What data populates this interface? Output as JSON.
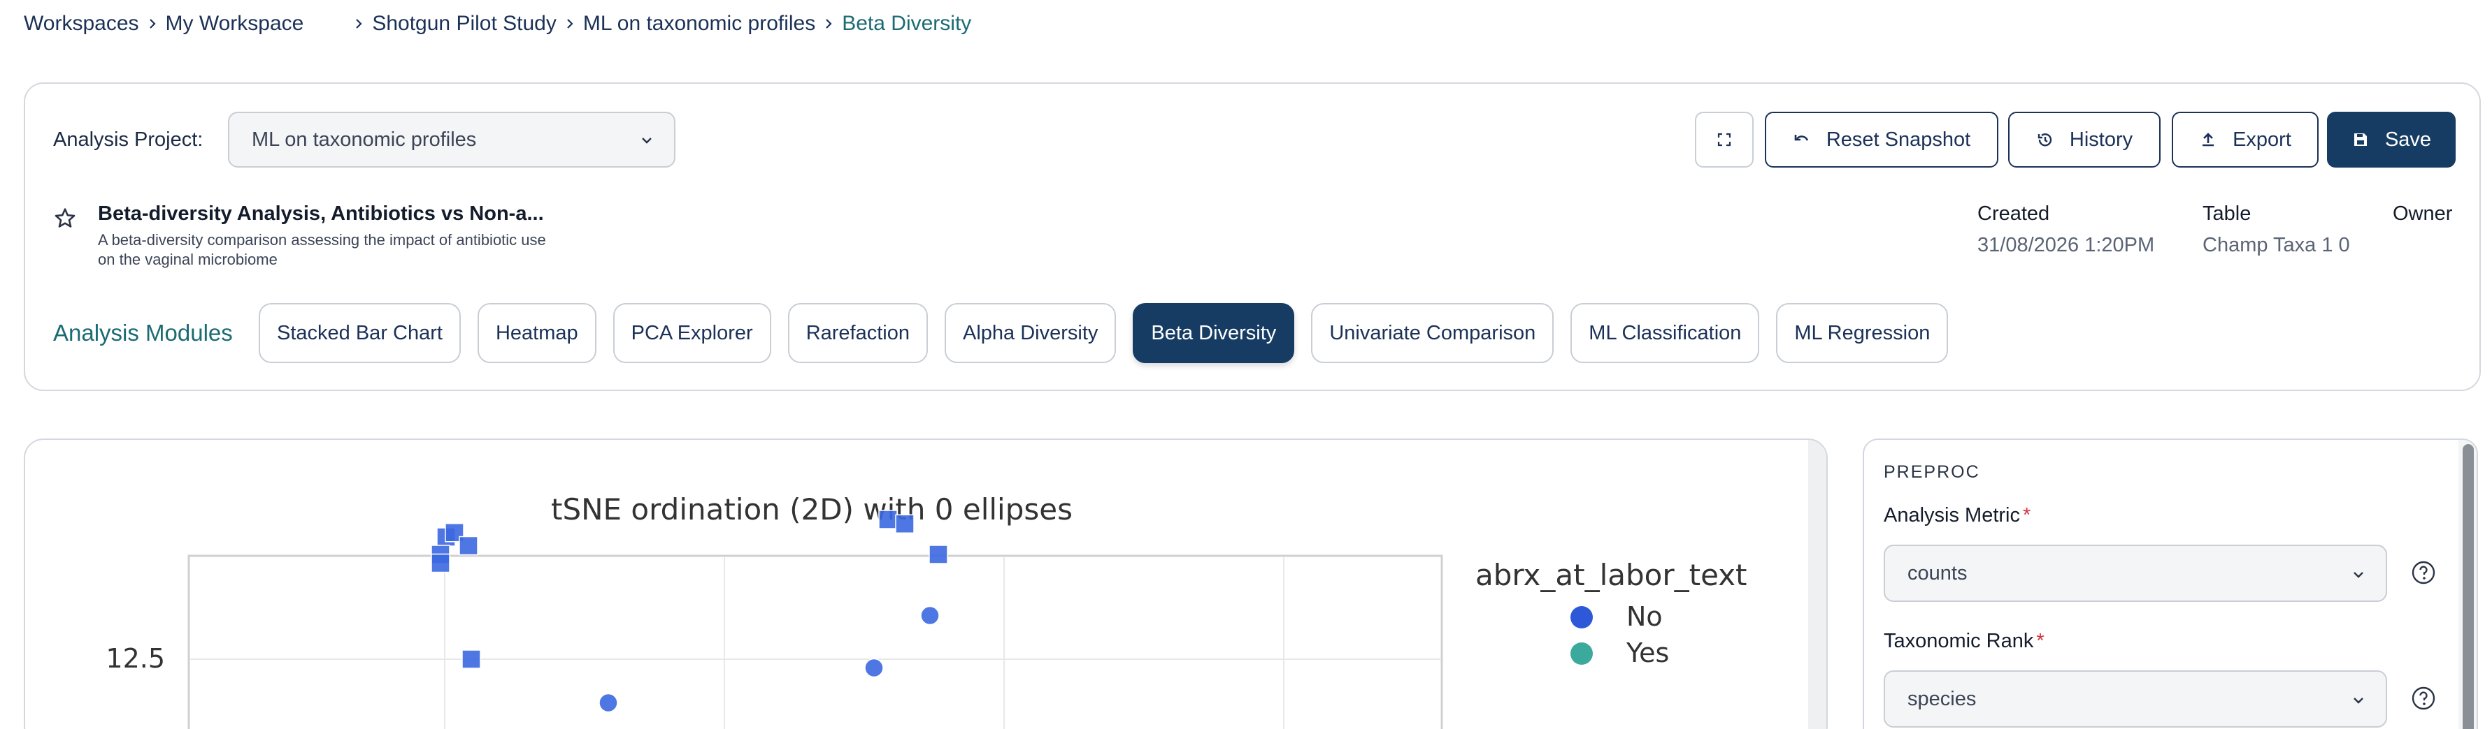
{
  "breadcrumb": {
    "items": [
      "Workspaces",
      "My Workspace",
      "Shotgun Pilot Study",
      "ML on taxonomic profiles",
      "Beta Diversity"
    ]
  },
  "project": {
    "label": "Analysis Project:",
    "selected": "ML on taxonomic profiles"
  },
  "toolbar": {
    "fullscreen_icon": "expand-icon",
    "reset_label": "Reset Snapshot",
    "history_label": "History",
    "export_label": "Export",
    "save_label": "Save"
  },
  "analysis": {
    "title": "Beta-diversity Analysis, Antibiotics vs Non-a...",
    "description": "A beta-diversity comparison assessing the impact of antibiotic use on the vaginal microbiome",
    "created_label": "Created",
    "created_value": "31/08/2026 1:20PM",
    "table_label": "Table",
    "table_value": "Champ Taxa 1 0",
    "owner_label": "Owner"
  },
  "modules": {
    "label": "Analysis Modules",
    "items": [
      "Stacked Bar Chart",
      "Heatmap",
      "PCA Explorer",
      "Rarefaction",
      "Alpha Diversity",
      "Beta Diversity",
      "Univariate Comparison",
      "ML Classification",
      "ML Regression"
    ],
    "active": "Beta Diversity"
  },
  "chart_data": {
    "type": "scatter",
    "title": "tSNE ordination (2D) with 0 ellipses",
    "ytick": "12.5",
    "legend": {
      "title": "abrx_at_labor_text",
      "entries": [
        {
          "label": "No",
          "color": "#2d59d9"
        },
        {
          "label": "Yes",
          "color": "#3ba99c"
        }
      ]
    },
    "series": [
      {
        "marker": "square",
        "color": "#3c68e0",
        "points": [
          [
            0.92,
            13.9
          ],
          [
            0.95,
            13.95
          ],
          [
            0.9,
            13.7
          ],
          [
            0.9,
            13.6
          ],
          [
            1.0,
            13.8
          ],
          [
            1.01,
            12.5
          ],
          [
            2.5,
            14.1
          ],
          [
            2.56,
            14.05
          ],
          [
            2.68,
            13.7
          ]
        ]
      },
      {
        "marker": "circle",
        "color": "#3c68e0",
        "points": [
          [
            1.5,
            12.0
          ],
          [
            2.45,
            12.4
          ],
          [
            2.65,
            13.0
          ]
        ]
      }
    ]
  },
  "panel": {
    "header": "PREPROC",
    "metric_label": "Analysis Metric",
    "metric_value": "counts",
    "rank_label": "Taxonomic Rank",
    "rank_value": "species"
  }
}
